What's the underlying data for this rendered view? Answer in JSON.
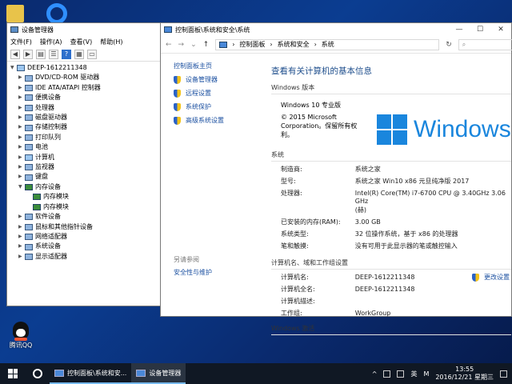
{
  "desktop": {
    "qq_label": "腾讯QQ"
  },
  "device_manager": {
    "title": "设备管理器",
    "menu": [
      "文件(F)",
      "操作(A)",
      "查看(V)",
      "帮助(H)"
    ],
    "tree": [
      {
        "label": "DEEP-1612211348",
        "level": 0,
        "expanded": true
      },
      {
        "label": "DVD/CD-ROM 驱动器",
        "level": 1
      },
      {
        "label": "IDE ATA/ATAPI 控制器",
        "level": 1
      },
      {
        "label": "便携设备",
        "level": 1
      },
      {
        "label": "处理器",
        "level": 1
      },
      {
        "label": "磁盘驱动器",
        "level": 1
      },
      {
        "label": "存储控制器",
        "level": 1
      },
      {
        "label": "打印队列",
        "level": 1
      },
      {
        "label": "电池",
        "level": 1
      },
      {
        "label": "计算机",
        "level": 1
      },
      {
        "label": "监视器",
        "level": 1
      },
      {
        "label": "键盘",
        "level": 1
      },
      {
        "label": "内存设备",
        "level": 1,
        "expanded": true
      },
      {
        "label": "内存模块",
        "level": 2
      },
      {
        "label": "内存模块",
        "level": 2
      },
      {
        "label": "软件设备",
        "level": 1
      },
      {
        "label": "鼠标和其他指针设备",
        "level": 1
      },
      {
        "label": "网络适配器",
        "level": 1
      },
      {
        "label": "系统设备",
        "level": 1
      },
      {
        "label": "显示适配器",
        "level": 1
      }
    ]
  },
  "control_panel": {
    "title": "控制面板\\系统和安全\\系统",
    "breadcrumb": [
      "控制面板",
      "系统和安全",
      "系统"
    ],
    "left": {
      "home": "控制面板主页",
      "links": [
        "设备管理器",
        "远程设置",
        "系统保护",
        "高级系统设置"
      ],
      "see_also": "另请参阅",
      "security": "安全性与维护"
    },
    "heading": "查看有关计算机的基本信息",
    "edition_section": "Windows 版本",
    "edition_name": "Windows 10 专业版",
    "copyright_1": "© 2015 Microsoft",
    "copyright_2": "Corporation。保留所有权",
    "copyright_3": "利。",
    "logo_text": "Windows",
    "system_section": "系统",
    "system_rows": [
      {
        "k": "制造商:",
        "v": "系统之家"
      },
      {
        "k": "型号:",
        "v": "系统之家 Win10 x86 元旦纯净版 2017"
      },
      {
        "k": "处理器:",
        "v": "Intel(R) Core(TM) i7-6700 CPU @ 3.40GHz   3.06 GHz"
      },
      {
        "k": "",
        "v": "(赫)"
      },
      {
        "k": "已安装的内存(RAM):",
        "v": "3.00 GB"
      },
      {
        "k": "系统类型:",
        "v": "32 位操作系统，基于 x86 的处理器"
      },
      {
        "k": "笔和触摸:",
        "v": "没有可用于此显示器的笔或触控输入"
      }
    ],
    "name_section": "计算机名、域和工作组设置",
    "change_settings": "更改设置",
    "name_rows": [
      {
        "k": "计算机名:",
        "v": "DEEP-1612211348"
      },
      {
        "k": "计算机全名:",
        "v": "DEEP-1612211348"
      },
      {
        "k": "计算机描述:",
        "v": ""
      },
      {
        "k": "工作组:",
        "v": "WorkGroup"
      }
    ],
    "activation_section": "Windows 激活"
  },
  "taskbar": {
    "tasks": [
      "控制面板\\系统和安...",
      "设备管理器"
    ],
    "ime": "英",
    "time": "13:55",
    "date": "2016/12/21 星期三"
  }
}
